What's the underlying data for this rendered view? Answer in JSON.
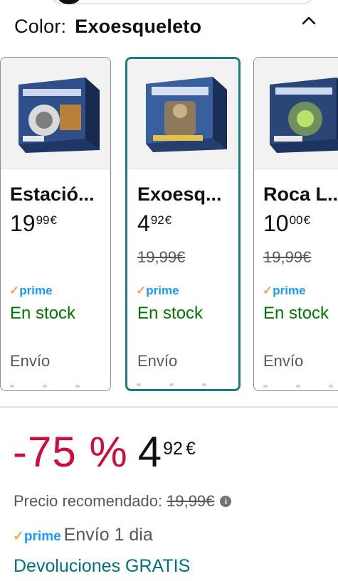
{
  "variation": {
    "label": "Color:",
    "selected": "Exoesqueleto"
  },
  "options": [
    {
      "name": "Estació...",
      "price_whole": "19",
      "price_fraction": "99",
      "currency": "€",
      "list_price": "",
      "prime": "prime",
      "prime_check": "✓",
      "stock": "En stock",
      "shipping": "Envío",
      "box_color": "#2f4f8a"
    },
    {
      "name": "Exoesq...",
      "price_whole": "4",
      "price_fraction": "92",
      "currency": "€",
      "list_price": "19,99€",
      "prime": "prime",
      "prime_check": "✓",
      "stock": "En stock",
      "shipping": "Envío",
      "box_color": "#3a5f9e"
    },
    {
      "name": "Roca L...",
      "price_whole": "10",
      "price_fraction": "00",
      "currency": "€",
      "list_price": "19,99€",
      "prime": "prime",
      "prime_check": "✓",
      "stock": "En stock",
      "shipping": "Envío",
      "box_color": "#2a4676"
    }
  ],
  "deal": {
    "discount": "-75 %",
    "price_whole": "4",
    "price_fraction": "92",
    "currency": "€"
  },
  "recommended": {
    "label": "Precio recomendado:",
    "price": "19,99€"
  },
  "delivery": {
    "prime_check": "✓",
    "prime": "prime",
    "text": "Envío 1 dia"
  },
  "returns": "Devoluciones GRATIS",
  "colors": {
    "selected_border": "#1d7b82",
    "discount_red": "#cc0c39",
    "stock_green": "#007600",
    "prime_blue": "#1a98ff",
    "link_teal": "#007185"
  },
  "icons": {
    "collapse": "chevron-up-icon",
    "info": "info-icon"
  }
}
